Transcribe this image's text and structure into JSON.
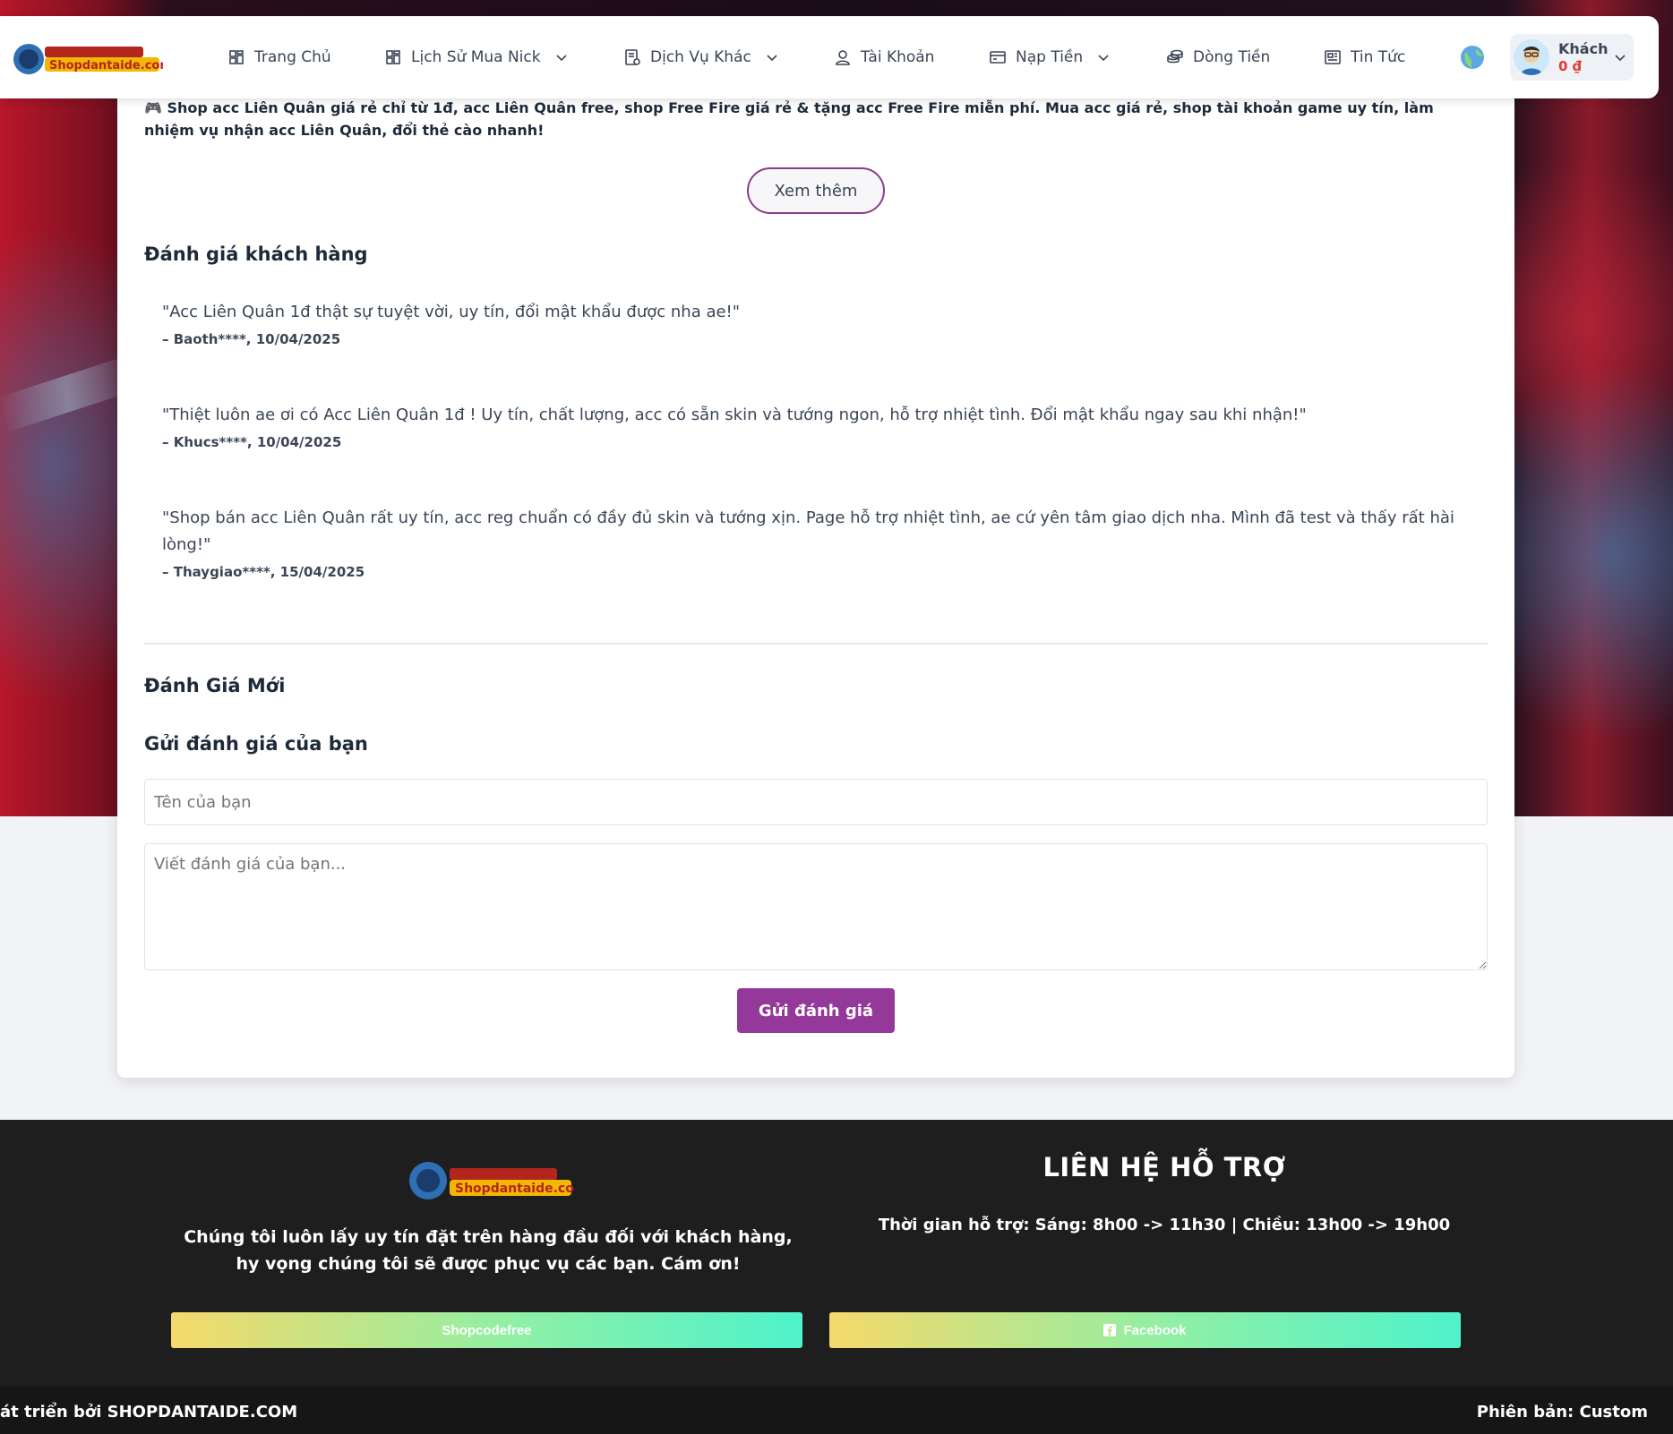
{
  "nav": {
    "logo_alt": "Shopdantaide.com",
    "items": [
      {
        "label": "Trang Chủ",
        "has_dropdown": false,
        "icon": "grid-icon"
      },
      {
        "label": "Lịch Sử Mua Nick",
        "has_dropdown": true,
        "icon": "grid-icon"
      },
      {
        "label": "Dịch Vụ Khác",
        "has_dropdown": true,
        "icon": "service-icon"
      },
      {
        "label": "Tài Khoản",
        "has_dropdown": false,
        "icon": "user-icon"
      },
      {
        "label": "Nạp Tiền",
        "has_dropdown": true,
        "icon": "card-icon"
      },
      {
        "label": "Dòng Tiền",
        "has_dropdown": false,
        "icon": "money-icon"
      },
      {
        "label": "Tin Tức",
        "has_dropdown": false,
        "icon": "news-icon"
      }
    ],
    "user": {
      "name": "Khách",
      "balance": "0 ₫"
    }
  },
  "intro": {
    "text": "🎮 Shop acc Liên Quân giá rẻ chỉ từ 1đ, acc Liên Quân free, shop Free Fire giá rẻ & tặng acc Free Fire miễn phí. Mua acc giá rẻ, shop tài khoản game uy tín, làm nhiệm vụ nhận acc Liên Quân, đổi thẻ cào nhanh!",
    "more_label": "Xem thêm"
  },
  "reviews": {
    "title": "Đánh giá khách hàng",
    "items": [
      {
        "text": "\"Acc Liên Quân 1đ thật sự tuyệt vời, uy tín, đổi mật khẩu được nha ae!\"",
        "meta": "– Baoth****, 10/04/2025"
      },
      {
        "text": "\"Thiệt luôn ae ơi có Acc Liên Quân 1đ ! Uy tín, chất lượng, acc có sẵn skin và tướng ngon, hỗ trợ nhiệt tình. Đổi mật khẩu ngay sau khi nhận!\"",
        "meta": "– Khucs****, 10/04/2025"
      },
      {
        "text": "\"Shop bán acc Liên Quân rất uy tín, acc reg chuẩn có đầy đủ skin và tướng xịn. Page hỗ trợ nhiệt tình, ae cứ yên tâm giao dịch nha. Mình đã test và thấy rất hài lòng!\"",
        "meta": "– Thaygiao****, 15/04/2025"
      }
    ]
  },
  "new_review": {
    "section_title": "Đánh Giá Mới",
    "form_title": "Gửi đánh giá của bạn",
    "name_placeholder": "Tên của bạn",
    "content_placeholder": "Viết đánh giá của bạn...",
    "submit_label": "Gửi đánh giá"
  },
  "footer": {
    "description": "Chúng tôi luôn lấy uy tín đặt trên hàng đầu đối với khách hàng, hy vọng chúng tôi sẽ được phục vụ các bạn. Cám ơn!",
    "contact_title": "LIÊN HỆ HỖ TRỢ",
    "support_hours": "Thời gian hỗ trợ: Sáng: 8h00 -> 11h30 | Chiều: 13h00 -> 19h00",
    "link_left": "Shopcodefree",
    "link_right": "Facebook",
    "developed_by": "át triển bởi SHOPDANTAIDE.COM",
    "version": "Phiên bản: Custom"
  },
  "colors": {
    "accent_purple": "#94389a",
    "balance_red": "#e53935",
    "footer_bg": "#1e1e1e"
  }
}
